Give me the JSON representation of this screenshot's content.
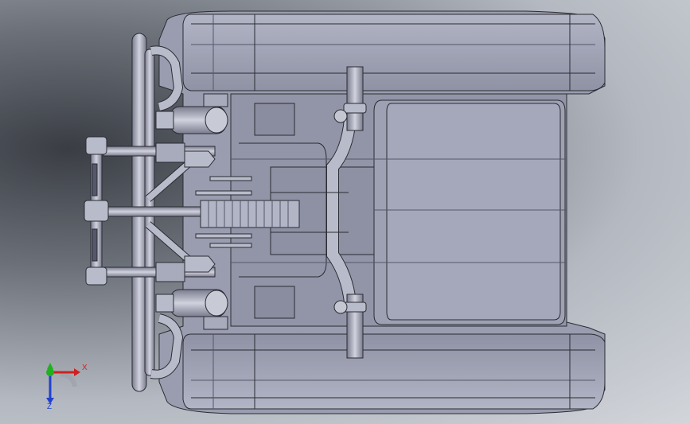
{
  "view": {
    "background_dark": "#3a3d44",
    "background_light": "#d2d5da",
    "body_fill": "#9ea1b3",
    "body_shadow": "#7a7c8e",
    "edge_color": "#2a2b33",
    "icon": "3d-cad-model"
  },
  "triad": {
    "x_label": "X",
    "z_label": "Z",
    "x_color": "#d02020",
    "y_color": "#20b020",
    "z_color": "#2040d0"
  }
}
